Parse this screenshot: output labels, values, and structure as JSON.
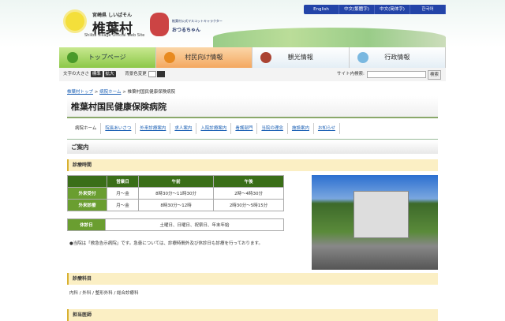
{
  "header": {
    "logo_prefix": "宮崎県",
    "logo_reading": "しいばそん",
    "logo_title": "椎葉村",
    "logo_sub": "Shiiba Village Official Web Site",
    "mascot_caption": "椎葉村公式マスコットキャラクター",
    "mascot_name": "おつるちゃん"
  },
  "languages": [
    "English",
    "中文(繁體字)",
    "中文(简体字)",
    "한국어"
  ],
  "nav": [
    "トップページ",
    "村民向け情報",
    "観光情報",
    "行政情報"
  ],
  "toolbar": {
    "font_size_label": "文字の大きさ",
    "standard": "標準",
    "large": "拡大",
    "bg_label": "背景色変更",
    "search_label": "サイト内検索:",
    "search_button": "検索"
  },
  "breadcrumb": [
    "椎葉村トップ",
    "病院ホーム",
    "椎葉村国民健康保険病院"
  ],
  "page_title": "椎葉村国民健康保険病院",
  "subnav": [
    "病院ホーム",
    "院長あいさつ",
    "外来診療案内",
    "求人案内",
    "入院診療案内",
    "看護部門",
    "当院の理念",
    "施設案内",
    "お知らせ"
  ],
  "guide": "ご案内",
  "sections": {
    "hours": "診療時間",
    "departments": "診療科目",
    "doctors": "担当医師"
  },
  "hours_table": {
    "headers": [
      "",
      "営業日",
      "午前",
      "午後"
    ],
    "rows": [
      [
        "外来受付",
        "月〜金",
        "8時30分〜11時30分",
        "2時〜4時30分"
      ],
      [
        "外来診療",
        "月〜金",
        "8時30分〜12時",
        "2時30分〜5時15分"
      ]
    ]
  },
  "closed": {
    "label": "休診日",
    "value": "土曜日、日曜日、祝祭日、年末年始"
  },
  "note": "●当院は「救急告示病院」です。急患については、診療時間外及び休診日も診療を行っております。",
  "departments_text": "内科 / 外科 / 整形外科 / 総合診療科"
}
